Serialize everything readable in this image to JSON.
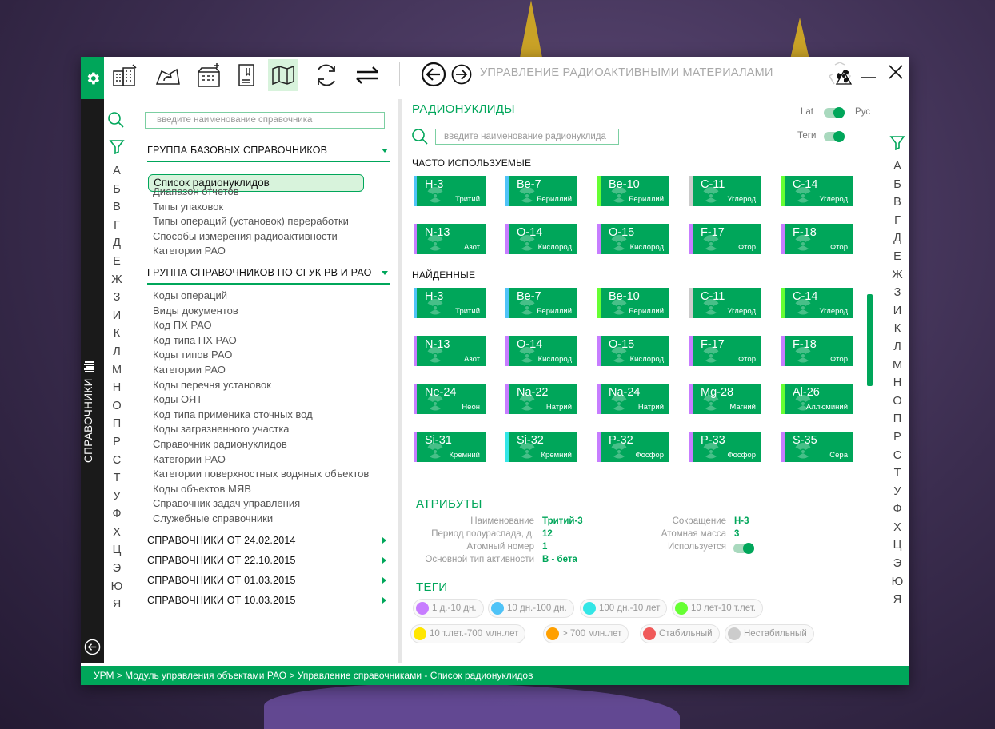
{
  "window": {
    "title": "УПРАВЛЕНИЕ РАДИОАКТИВНЫМИ МАТЕРИАЛАМИ",
    "toolbar_icons": [
      "gear-icon",
      "building-edit-icon",
      "recycle-area-icon",
      "building-add-icon",
      "document-icon",
      "map-icon",
      "sync-icon",
      "swap-icon"
    ],
    "nav": [
      "back-icon",
      "forward-icon"
    ]
  },
  "vertical_label": "СПРАВОЧНИКИ",
  "alphabet": [
    "А",
    "Б",
    "В",
    "Г",
    "Д",
    "Е",
    "Ж",
    "З",
    "И",
    "К",
    "Л",
    "М",
    "Н",
    "О",
    "П",
    "Р",
    "С",
    "Т",
    "У",
    "Ф",
    "Х",
    "Ц",
    "Э",
    "Ю",
    "Я"
  ],
  "sidebar": {
    "search_placeholder": "введите наименование справочника",
    "group1": {
      "title": "ГРУППА БАЗОВЫХ СПРАВОЧНИКОВ",
      "selected": "Список радионуклидов",
      "items": [
        "Диапазон отчетов",
        "Типы упаковок",
        "Типы операций (установок) переработки",
        "Способы измерения радиоактивности",
        "Категории РАО"
      ]
    },
    "group2": {
      "title": "ГРУППА СПРАВОЧНИКОВ ПО СГУК РВ И РАО",
      "items": [
        "Коды операций",
        "Виды документов",
        "Код ПХ РАО",
        "Код типа ПХ РАО",
        "Коды типов РАО",
        "Категории РАО",
        "Коды перечня установок",
        "Коды ОЯТ",
        "Код типа применика сточных вод",
        "Коды загрязненного участка",
        "Справочник радионуклидов",
        "Категории РАО",
        "Категории поверхностных водяных объектов",
        "Коды объектов МЯВ",
        "Справочник задач управления",
        "Служебные справочники"
      ]
    },
    "collapsed_groups": [
      "СПРАВОЧНИКИ ОТ 24.02.2014",
      "СПРАВОЧНИКИ ОТ 22.10.2015",
      "СПРАВОЧНИКИ ОТ 01.03.2015",
      "СПРАВОЧНИКИ ОТ 10.03.2015"
    ]
  },
  "main": {
    "title": "РАДИОНУКЛИДЫ",
    "lat_label": "Lat",
    "rus_label": "Рус",
    "tags_label": "Теги",
    "search_placeholder": "введите наименование радионуклида",
    "frequent_title": "ЧАСТО ИСПОЛЬЗУЕМЫЕ",
    "found_title": "НАЙДЕННЫЕ",
    "frequent": [
      {
        "sym": "H-3",
        "name": "Тритий",
        "stripe": "#4fc3f7"
      },
      {
        "sym": "Be-7",
        "name": "Бериллий",
        "stripe": "#4fc3f7"
      },
      {
        "sym": "Be-10",
        "name": "Бериллий",
        "stripe": "#66ff33"
      },
      {
        "sym": "C-11",
        "name": "Углерод",
        "stripe": "#cccccc"
      },
      {
        "sym": "C-14",
        "name": "Углерод",
        "stripe": "#66ff33"
      },
      {
        "sym": "N-13",
        "name": "Азот",
        "stripe": "#c77dff"
      },
      {
        "sym": "O-14",
        "name": "Кислород",
        "stripe": "#c77dff"
      },
      {
        "sym": "O-15",
        "name": "Кислород",
        "stripe": "#c77dff"
      },
      {
        "sym": "F-17",
        "name": "Фтор",
        "stripe": "#c77dff"
      },
      {
        "sym": "F-18",
        "name": "Фтор",
        "stripe": "#c77dff"
      }
    ],
    "found": [
      {
        "sym": "H-3",
        "name": "Тритий",
        "stripe": "#4fc3f7"
      },
      {
        "sym": "Be-7",
        "name": "Бериллий",
        "stripe": "#4fc3f7"
      },
      {
        "sym": "Be-10",
        "name": "Бериллий",
        "stripe": "#66ff33"
      },
      {
        "sym": "C-11",
        "name": "Углерод",
        "stripe": "#cccccc"
      },
      {
        "sym": "C-14",
        "name": "Углерод",
        "stripe": "#66ff33"
      },
      {
        "sym": "N-13",
        "name": "Азот",
        "stripe": "#c77dff"
      },
      {
        "sym": "O-14",
        "name": "Кислород",
        "stripe": "#c77dff"
      },
      {
        "sym": "O-15",
        "name": "Кислород",
        "stripe": "#c77dff"
      },
      {
        "sym": "F-17",
        "name": "Фтор",
        "stripe": "#c77dff"
      },
      {
        "sym": "F-18",
        "name": "Фтор",
        "stripe": "#c77dff"
      },
      {
        "sym": "Ne-24",
        "name": "Неон",
        "stripe": "#c77dff"
      },
      {
        "sym": "Na-22",
        "name": "Натрий",
        "stripe": "#c77dff"
      },
      {
        "sym": "Na-24",
        "name": "Натрий",
        "stripe": "#c77dff"
      },
      {
        "sym": "Mg-28",
        "name": "Магний",
        "stripe": "#c77dff"
      },
      {
        "sym": "Al-26",
        "name": "Аллюминий",
        "stripe": "#66ff33"
      },
      {
        "sym": "Si-31",
        "name": "Кремний",
        "stripe": "#c77dff"
      },
      {
        "sym": "Si-32",
        "name": "Кремний",
        "stripe": "#33e6e6"
      },
      {
        "sym": "P-32",
        "name": "Фосфор",
        "stripe": "#c77dff"
      },
      {
        "sym": "P-33",
        "name": "Фосфор",
        "stripe": "#c77dff"
      },
      {
        "sym": "S-35",
        "name": "Сера",
        "stripe": "#c77dff"
      }
    ]
  },
  "attributes": {
    "title": "АТРИБУТЫ",
    "name_label": "Наименование",
    "name_value": "Тритий-3",
    "halflife_label": "Период полураспада, д.",
    "halflife_value": "12",
    "atomic_number_label": "Атомный номер",
    "atomic_number_value": "1",
    "activity_label": "Основной тип активности",
    "activity_value": "B - бета",
    "abbr_label": "Сокращение",
    "abbr_value": "H-3",
    "mass_label": "Атомная масса",
    "mass_value": "3",
    "used_label": "Используется"
  },
  "tags": {
    "title": "ТЕГИ",
    "items": [
      {
        "label": "1 д.-10 дн.",
        "color": "#c77dff"
      },
      {
        "label": "10 дн.-100 дн.",
        "color": "#4fc3f7"
      },
      {
        "label": "100 дн.-10 лет",
        "color": "#33e6e6"
      },
      {
        "label": "10 лет-10 т.лет.",
        "color": "#66ff33"
      },
      {
        "label": "10 т.лет.-700 млн.лет",
        "color": "#ffe600"
      },
      {
        "label": "> 700 млн.лет",
        "color": "#ffa000"
      },
      {
        "label": "Стабильный",
        "color": "#f05a5a"
      },
      {
        "label": "Нестабильный",
        "color": "#cccccc"
      }
    ]
  },
  "footer": {
    "breadcrumb": "УРМ > Модуль управления объектами РАО > Управление справочниками - Список радионуклидов"
  },
  "accent_color": "#00a65a"
}
